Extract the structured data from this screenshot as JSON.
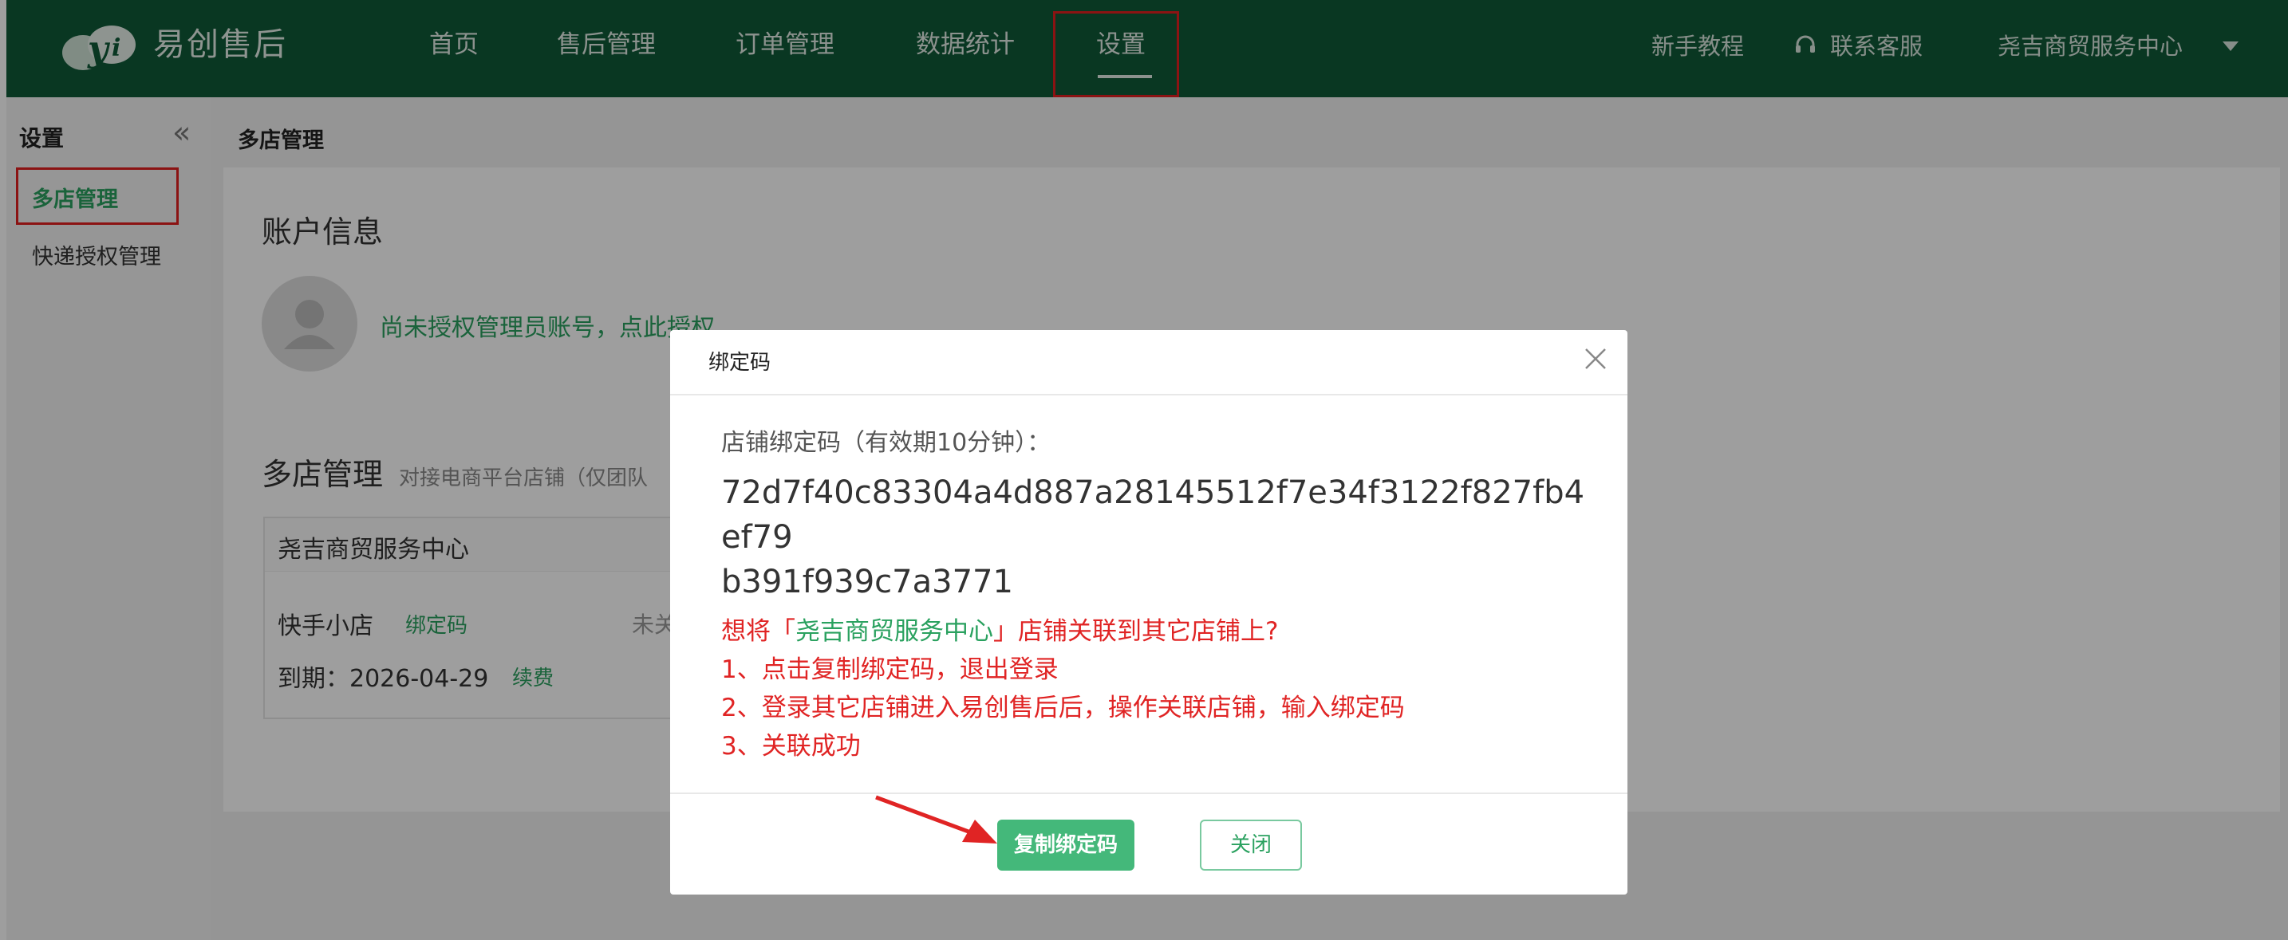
{
  "app": {
    "brand": "易创售后",
    "nav": [
      "首页",
      "售后管理",
      "订单管理",
      "数据统计",
      "设置"
    ],
    "active_nav": "设置",
    "tutorial": "新手教程",
    "support": "联系客服",
    "account": "尧吉商贸服务中心"
  },
  "sidebar": {
    "title": "设置",
    "items": [
      "多店管理",
      "快递授权管理"
    ],
    "active_item": "多店管理"
  },
  "main": {
    "breadcrumb": "多店管理",
    "account_section": {
      "title": "账户信息",
      "unauthorized_link": "尚未授权管理员账号，点此授权"
    },
    "multi_shop_section": {
      "title": "多店管理",
      "subtitle": "对接电商平台店铺（仅团队"
    },
    "shop": {
      "name": "尧吉商贸服务中心",
      "platform": "快手小店",
      "bind_code_link": "绑定码",
      "status_partial": "未关",
      "expire_label": "到期：2026-04-29",
      "renew_link": "续费"
    }
  },
  "modal": {
    "title": "绑定码",
    "code_label": "店铺绑定码（有效期10分钟）：",
    "code_line1": "72d7f40c83304a4d887a28145512f7e34f3122f827fb4ef79",
    "code_line2": "b391f939c7a3771",
    "tip_question_pre": "想将「",
    "tip_question_shop": "尧吉商贸服务中心",
    "tip_question_post": "」店铺关联到其它店铺上?",
    "steps": [
      "1、点击复制绑定码，退出登录",
      "2、登录其它店铺进入易创售后后，操作关联店铺，输入绑定码",
      "3、关联成功"
    ],
    "copy_button": "复制绑定码",
    "close_button": "关闭"
  },
  "colors": {
    "topbar": "#0f5a38",
    "accent_green": "#2aa15f",
    "button_green": "#44b87a",
    "highlight_red": "#e02020"
  }
}
